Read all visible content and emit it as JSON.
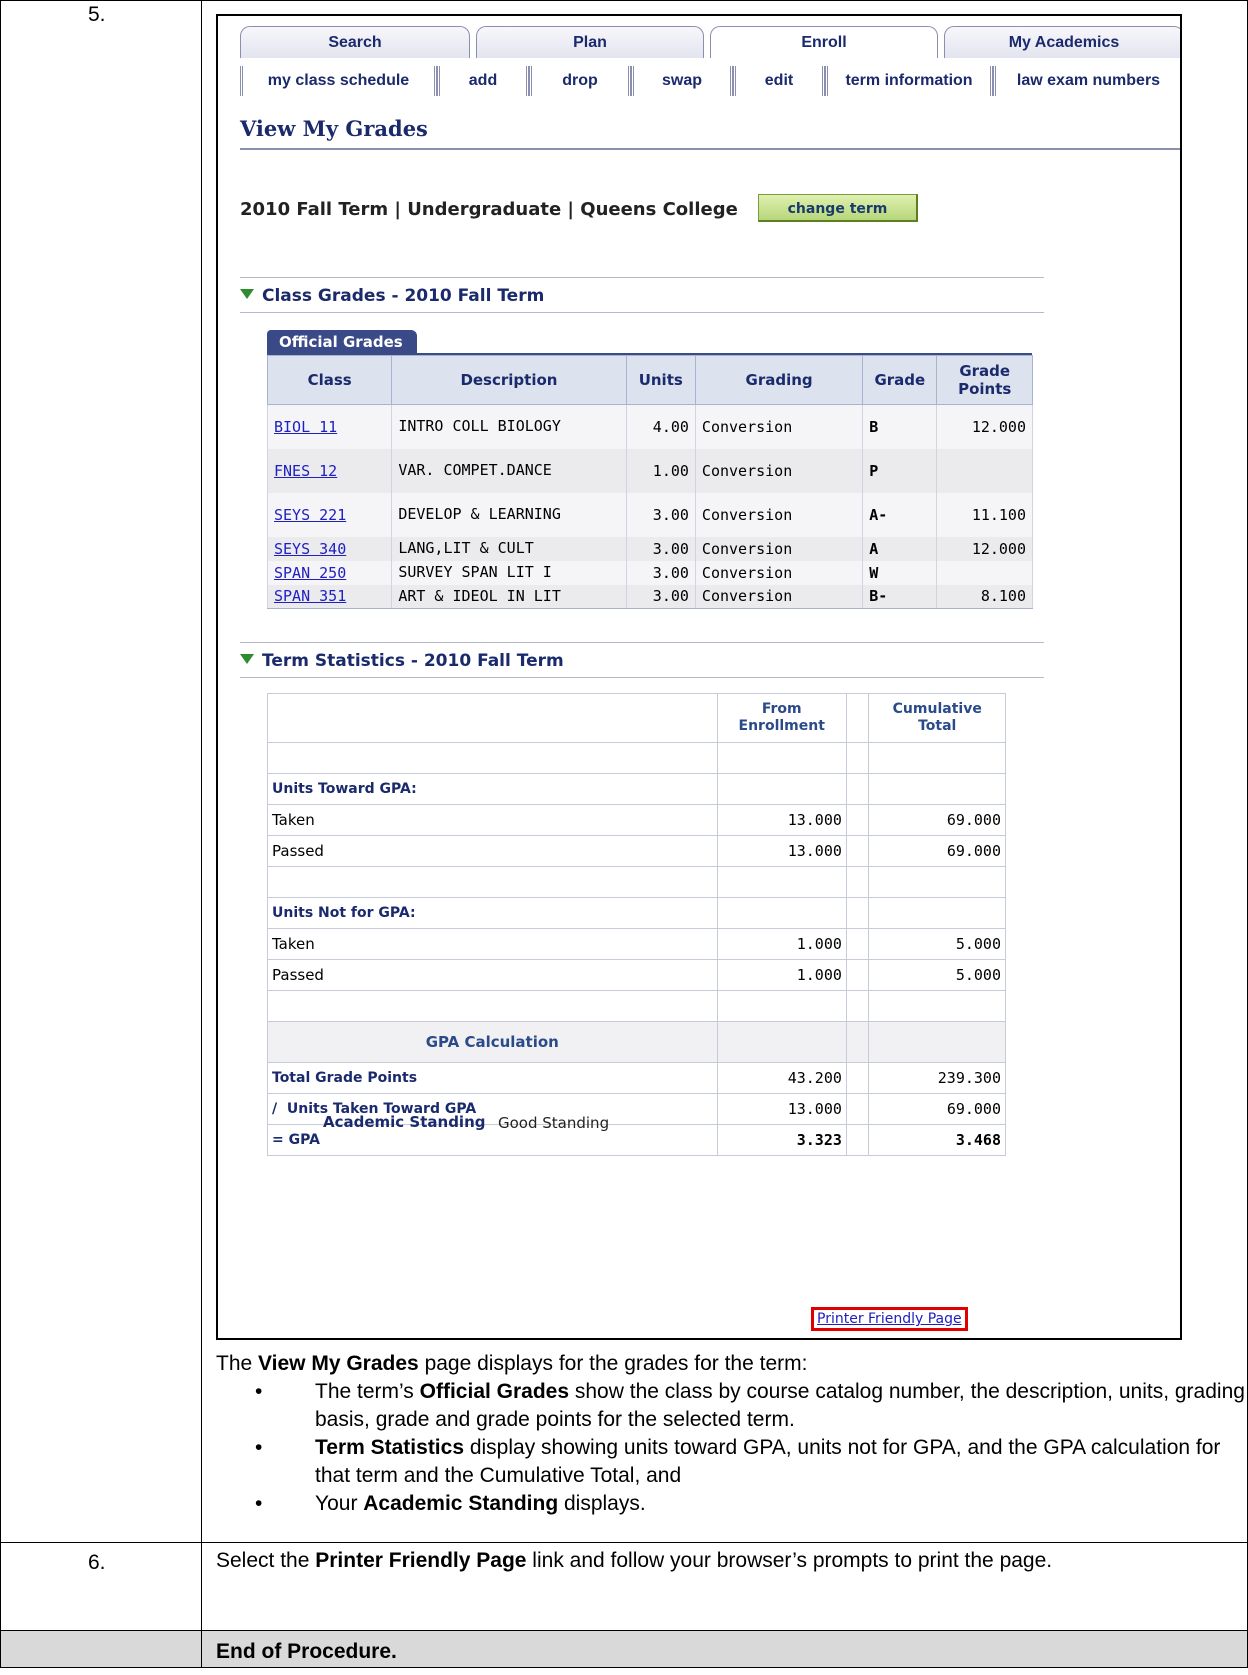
{
  "steps": [
    {
      "number": "5."
    },
    {
      "number": "6.",
      "text_parts": [
        "Select the ",
        "Printer Friendly Page",
        " link and follow your browser’s prompts to print the page."
      ]
    }
  ],
  "end_text": "End of Procedure.",
  "screenshot": {
    "tabs": [
      "Search",
      "Plan",
      "Enroll",
      "My Academics"
    ],
    "active_tab": "Enroll",
    "subtabs": [
      "my class schedule",
      "add",
      "drop",
      "swap",
      "edit",
      "term information",
      "law exam numbers"
    ],
    "page_title": "View My Grades",
    "term_line": "2010 Fall Term | Undergraduate | Queens College",
    "change_term_label": "change term",
    "class_grades_title": "Class Grades - 2010 Fall Term",
    "official_grades_tab": "Official Grades",
    "grades_headers": [
      "Class",
      "Description",
      "Units",
      "Grading",
      "Grade",
      "Grade Points"
    ],
    "grades_rows": [
      {
        "class": "BIOL 11",
        "description": "INTRO COLL BIOLOGY",
        "units": "4.00",
        "grading": "Conversion",
        "grade": "B",
        "points": "12.000"
      },
      {
        "class": "FNES 12",
        "description": "VAR. COMPET.DANCE",
        "units": "1.00",
        "grading": "Conversion",
        "grade": "P",
        "points": ""
      },
      {
        "class": "SEYS 221",
        "description": "DEVELOP & LEARNING",
        "units": "3.00",
        "grading": "Conversion",
        "grade": "A-",
        "points": "11.100"
      },
      {
        "class": "SEYS 340",
        "description": "LANG,LIT & CULT",
        "units": "3.00",
        "grading": "Conversion",
        "grade": "A",
        "points": "12.000"
      },
      {
        "class": "SPAN 250",
        "description": "SURVEY SPAN LIT I",
        "units": "3.00",
        "grading": "Conversion",
        "grade": "W",
        "points": ""
      },
      {
        "class": "SPAN 351",
        "description": "ART & IDEOL IN LIT",
        "units": "3.00",
        "grading": "Conversion",
        "grade": "B-",
        "points": "8.100"
      }
    ],
    "term_stats_title": "Term Statistics - 2010 Fall Term",
    "stats_headers": {
      "from": "From Enrollment",
      "cum": "Cumulative Total"
    },
    "units_toward_gpa_label": "Units Toward GPA:",
    "units_not_gpa_label": "Units Not for GPA:",
    "taken_label": "Taken",
    "passed_label": "Passed",
    "toward": {
      "taken": [
        "13.000",
        "69.000"
      ],
      "passed": [
        "13.000",
        "69.000"
      ]
    },
    "not_for": {
      "taken": [
        "1.000",
        "5.000"
      ],
      "passed": [
        "1.000",
        "5.000"
      ]
    },
    "gpa_calc_label": "GPA Calculation",
    "total_grade_points_label": "Total Grade Points",
    "total_grade_points": [
      "43.200",
      "239.300"
    ],
    "units_taken_label": "/  Units Taken Toward GPA",
    "units_taken": [
      "13.000",
      "69.000"
    ],
    "gpa_label": "= GPA",
    "gpa": [
      "3.323",
      "3.468"
    ],
    "academic_standing_label": "Academic Standing",
    "academic_standing_value": "Good Standing",
    "printer_link": "Printer Friendly Page"
  },
  "description": {
    "intro_parts": [
      "The ",
      "View My Grades",
      " page displays for the grades for the term:"
    ],
    "bullets": [
      [
        "The term’s ",
        "Official Grades",
        " show the class by course catalog number, the description, units, grading basis, grade and grade points for the selected term."
      ],
      [
        "",
        "Term Statistics",
        " display showing units toward GPA, units not for GPA, and the GPA calculation for that term and the Cumulative Total, and"
      ],
      [
        "Your ",
        "Academic Standing",
        " displays."
      ]
    ]
  }
}
